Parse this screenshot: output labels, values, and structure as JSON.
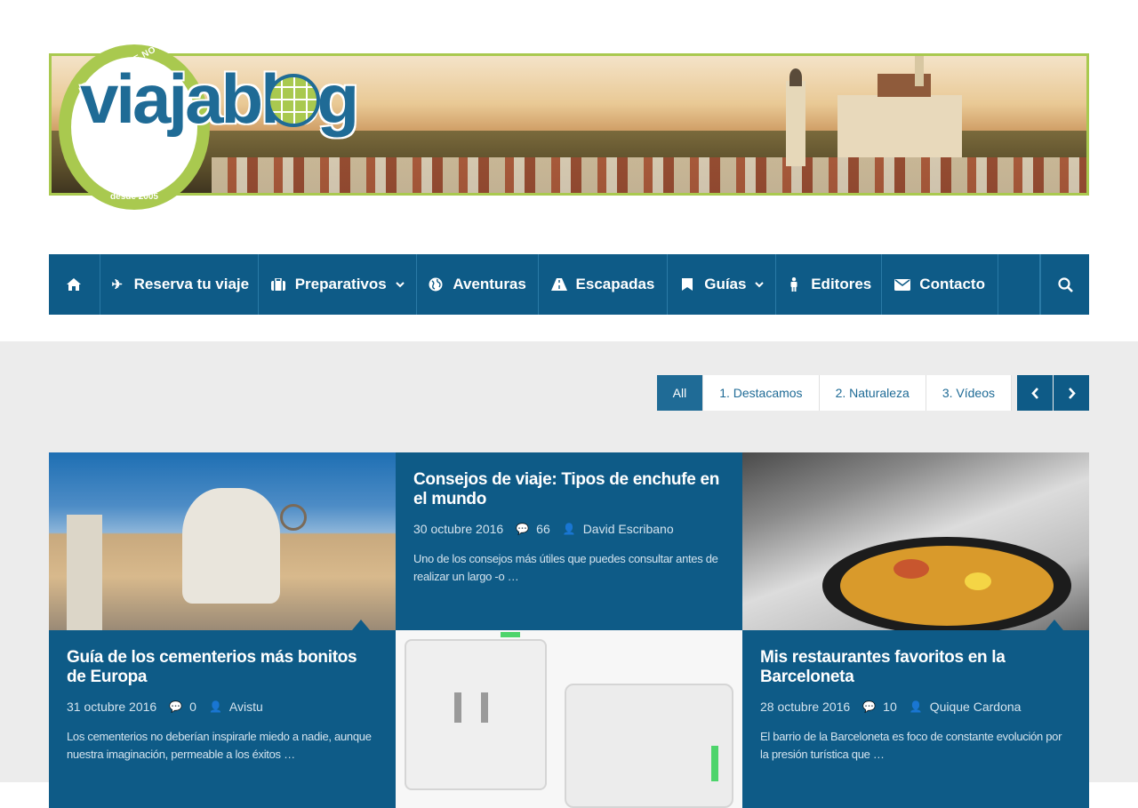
{
  "header": {
    "logo_arc_text": "EL BLOG QUE NO PARA DE VIAJAR",
    "logo_wordmark": "viajablog",
    "logo_since": "desde 2005"
  },
  "nav": {
    "items": [
      {
        "label": "Reserva tu viaje",
        "icon": "plane-icon"
      },
      {
        "label": "Preparativos",
        "icon": "suitcase-icon",
        "dropdown": true
      },
      {
        "label": "Aventuras",
        "icon": "globe-icon"
      },
      {
        "label": "Escapadas",
        "icon": "road-icon"
      },
      {
        "label": "Guías",
        "icon": "bookmark-icon",
        "dropdown": true
      },
      {
        "label": "Editores",
        "icon": "person-icon"
      },
      {
        "label": "Contacto",
        "icon": "envelope-icon"
      }
    ]
  },
  "filters": {
    "items": [
      "All",
      "1. Destacamos",
      "2. Naturaleza",
      "3. Vídeos"
    ],
    "active": "All"
  },
  "posts": [
    {
      "title": "Consejos de viaje: Tipos de enchufe en el mundo",
      "date": "30 octubre 2016",
      "comments": "66",
      "author": "David Escribano",
      "excerpt": "Uno de los consejos más útiles que puedes consultar antes de realizar un largo -o",
      "more": "…"
    },
    {
      "title": "Guía de los cementerios más bonitos de Europa",
      "date": "31 octubre 2016",
      "comments": "0",
      "author": "Avistu",
      "excerpt": "Los cementerios no deberían inspirarle miedo a nadie, aunque nuestra imaginación, permeable a los éxitos",
      "more": "…"
    },
    {
      "title": "Mis restaurantes favoritos en la Barceloneta",
      "date": "28 octubre 2016",
      "comments": "10",
      "author": "Quique Cardona",
      "excerpt": "El barrio de la Barceloneta es foco de constante evolución por la presión turística que",
      "more": "…"
    }
  ],
  "colors": {
    "nav_bg": "#0e5b87",
    "accent_green": "#a9c94f",
    "link_blue": "#1f6b96"
  }
}
